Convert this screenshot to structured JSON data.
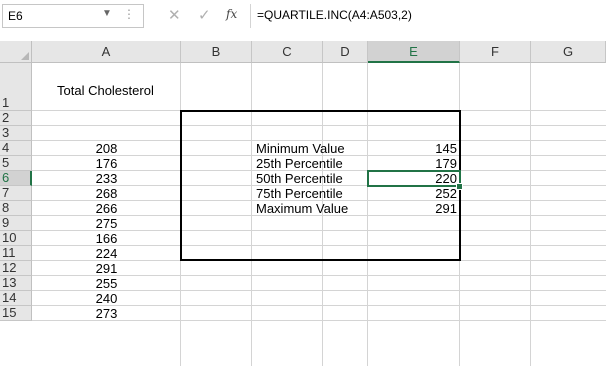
{
  "formula_bar": {
    "name_box": "E6",
    "cancel_icon": "✕",
    "enter_icon": "✓",
    "fx_label": "fx",
    "formula": "=QUARTILE.INC(A4:A503,2)"
  },
  "columns": [
    "A",
    "B",
    "C",
    "D",
    "E",
    "F",
    "G"
  ],
  "rows": [
    "1",
    "2",
    "3",
    "4",
    "5",
    "6",
    "7",
    "8",
    "9",
    "10",
    "11",
    "12",
    "13",
    "14",
    "15"
  ],
  "selected_cell": "E6",
  "cells": {
    "a1": "Total Cholesterol",
    "a_values": [
      "208",
      "176",
      "233",
      "268",
      "266",
      "275",
      "166",
      "224",
      "291",
      "255",
      "240",
      "273"
    ],
    "labels": [
      "Minimum Value",
      "25th Percentile",
      "50th Percentile",
      "75th Percentile",
      "Maximum Value"
    ],
    "results": [
      "145",
      "179",
      "220",
      "252",
      "291"
    ]
  }
}
